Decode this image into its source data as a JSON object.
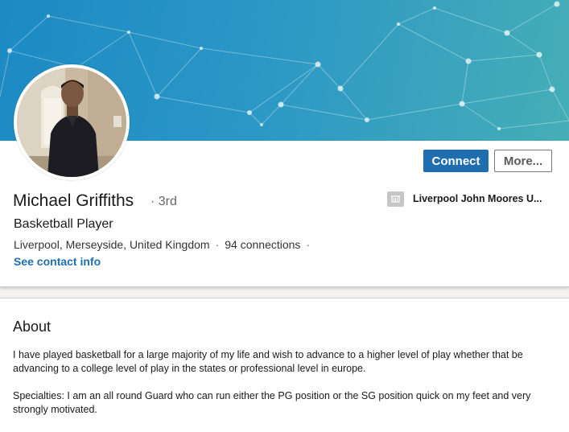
{
  "profile": {
    "name": "Michael Griffiths",
    "degree": "· 3rd",
    "headline": "Basketball Player",
    "location": "Liverpool, Merseyside, United Kingdom",
    "separator": "·",
    "connections": "94 connections",
    "trailing_separator": "·",
    "contact_link": "See contact info",
    "school": "Liverpool John Moores U..."
  },
  "actions": {
    "connect_label": "Connect",
    "more_label": "More..."
  },
  "about": {
    "title": "About",
    "paragraph_1": "I have played basketball for a large majority of my life and wish to advance to a higher level of play whether that be advancing to a college level of play in the states or professional level in europe.",
    "paragraph_2": "Specialties: I am an all round Guard who can run either the PG position or the SG position quick on my feet and very strongly motivated."
  },
  "colors": {
    "primary_button": "#1f6fb0",
    "link": "#1f6fb0",
    "banner_start": "#1c8ac4",
    "banner_end": "#45aeb6"
  },
  "icons": {
    "school_logo": "building-icon"
  }
}
